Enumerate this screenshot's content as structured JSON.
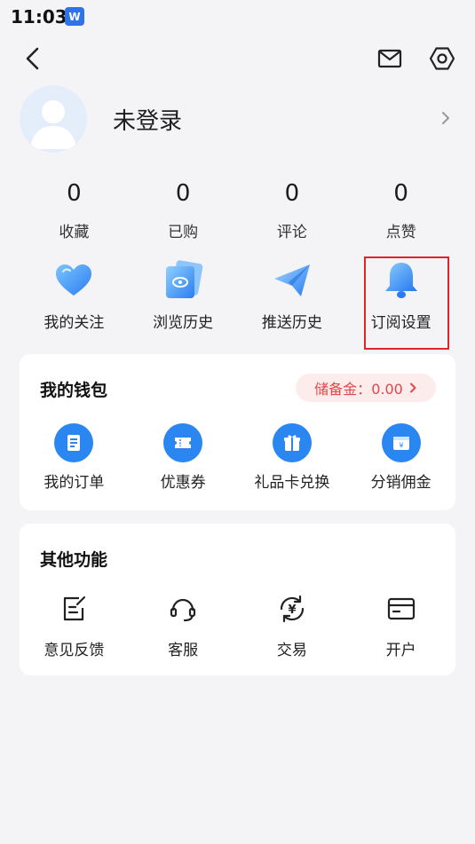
{
  "status_bar": {
    "time": "11:03",
    "app_icon_letter": "W"
  },
  "top_bar": {
    "icons": [
      "back-icon",
      "mail-icon",
      "settings-icon"
    ]
  },
  "profile": {
    "username": "未登录"
  },
  "stats": [
    {
      "value": "0",
      "label": "收藏"
    },
    {
      "value": "0",
      "label": "已购"
    },
    {
      "value": "0",
      "label": "评论"
    },
    {
      "value": "0",
      "label": "点赞"
    }
  ],
  "quick_actions": [
    {
      "label": "我的关注",
      "icon": "heart-icon"
    },
    {
      "label": "浏览历史",
      "icon": "eye-card-icon"
    },
    {
      "label": "推送历史",
      "icon": "paper-plane-icon"
    },
    {
      "label": "订阅设置",
      "icon": "bell-icon"
    }
  ],
  "wallet": {
    "title": "我的钱包",
    "reserve_label": "储备金：",
    "reserve_value": "0.00",
    "items": [
      {
        "label": "我的订单",
        "icon": "order-icon"
      },
      {
        "label": "优惠券",
        "icon": "coupon-icon"
      },
      {
        "label": "礼品卡兑换",
        "icon": "gift-icon"
      },
      {
        "label": "分销佣金",
        "icon": "commission-icon"
      }
    ]
  },
  "other": {
    "title": "其他功能",
    "items": [
      {
        "label": "意见反馈",
        "icon": "feedback-icon"
      },
      {
        "label": "客服",
        "icon": "headset-icon"
      },
      {
        "label": "交易",
        "icon": "exchange-icon"
      },
      {
        "label": "开户",
        "icon": "card-icon"
      }
    ]
  },
  "colors": {
    "accent": "#2a86f0",
    "reserve_text": "#e1474b",
    "reserve_bg": "#fdecec",
    "highlight": "#e0242b",
    "page_bg": "#f4f4f6"
  }
}
